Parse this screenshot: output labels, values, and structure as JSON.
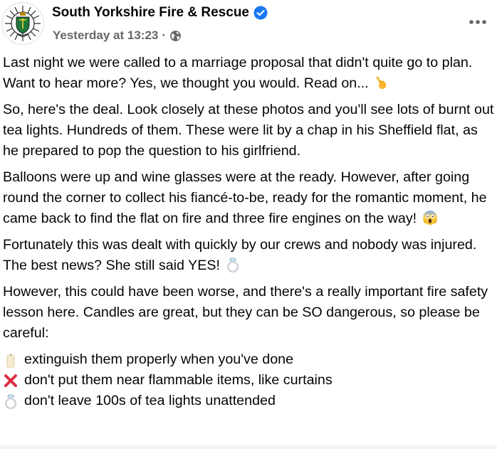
{
  "post": {
    "author": "South Yorkshire Fire & Rescue",
    "timestamp": "Yesterday at 13:23",
    "separator": "·",
    "verified": true,
    "privacy_icon": "globe-icon",
    "more_icon": "more-options-icon",
    "paragraphs": [
      {
        "text": "Last night we were called to a marriage proposal that didn't quite go to plan. Want to hear more? Yes, we thought you would. Read on... ",
        "emoji": "backhand-index-pointing-down-emoji"
      },
      {
        "text": "So, here's the deal. Look closely at these photos and you'll see lots of burnt out tea lights. Hundreds of them. These were lit by a chap in his Sheffield flat, as he prepared to pop the question to his girlfriend."
      },
      {
        "text": "Balloons were up and wine glasses were at the ready. However, after going round the corner to collect his fiancé-to-be, ready for the romantic moment, he came back to find the flat on fire and three fire engines on the way! ",
        "emoji": "screaming-face-emoji"
      },
      {
        "text": "Fortunately this was dealt with quickly by our crews and nobody was injured. The best news? She still said YES! ",
        "emoji": "ring-emoji"
      },
      {
        "text": "However, this could have been worse, and there's a really important fire safety lesson here. Candles are great, but they can be SO dangerous, so please be careful:"
      }
    ],
    "list": [
      {
        "icon": "candle-emoji",
        "text": "extinguish them properly when you've done"
      },
      {
        "icon": "cross-mark-emoji",
        "text": "don't put them near flammable items, like curtains"
      },
      {
        "icon": "ring-emoji",
        "text": "don't leave 100s of tea lights unattended"
      }
    ]
  },
  "colors": {
    "text": "#050505",
    "secondary": "#65676b",
    "verified_blue": "#1877f2",
    "cross_red": "#dd2e44",
    "hand_yellow": "#fbb32f"
  }
}
